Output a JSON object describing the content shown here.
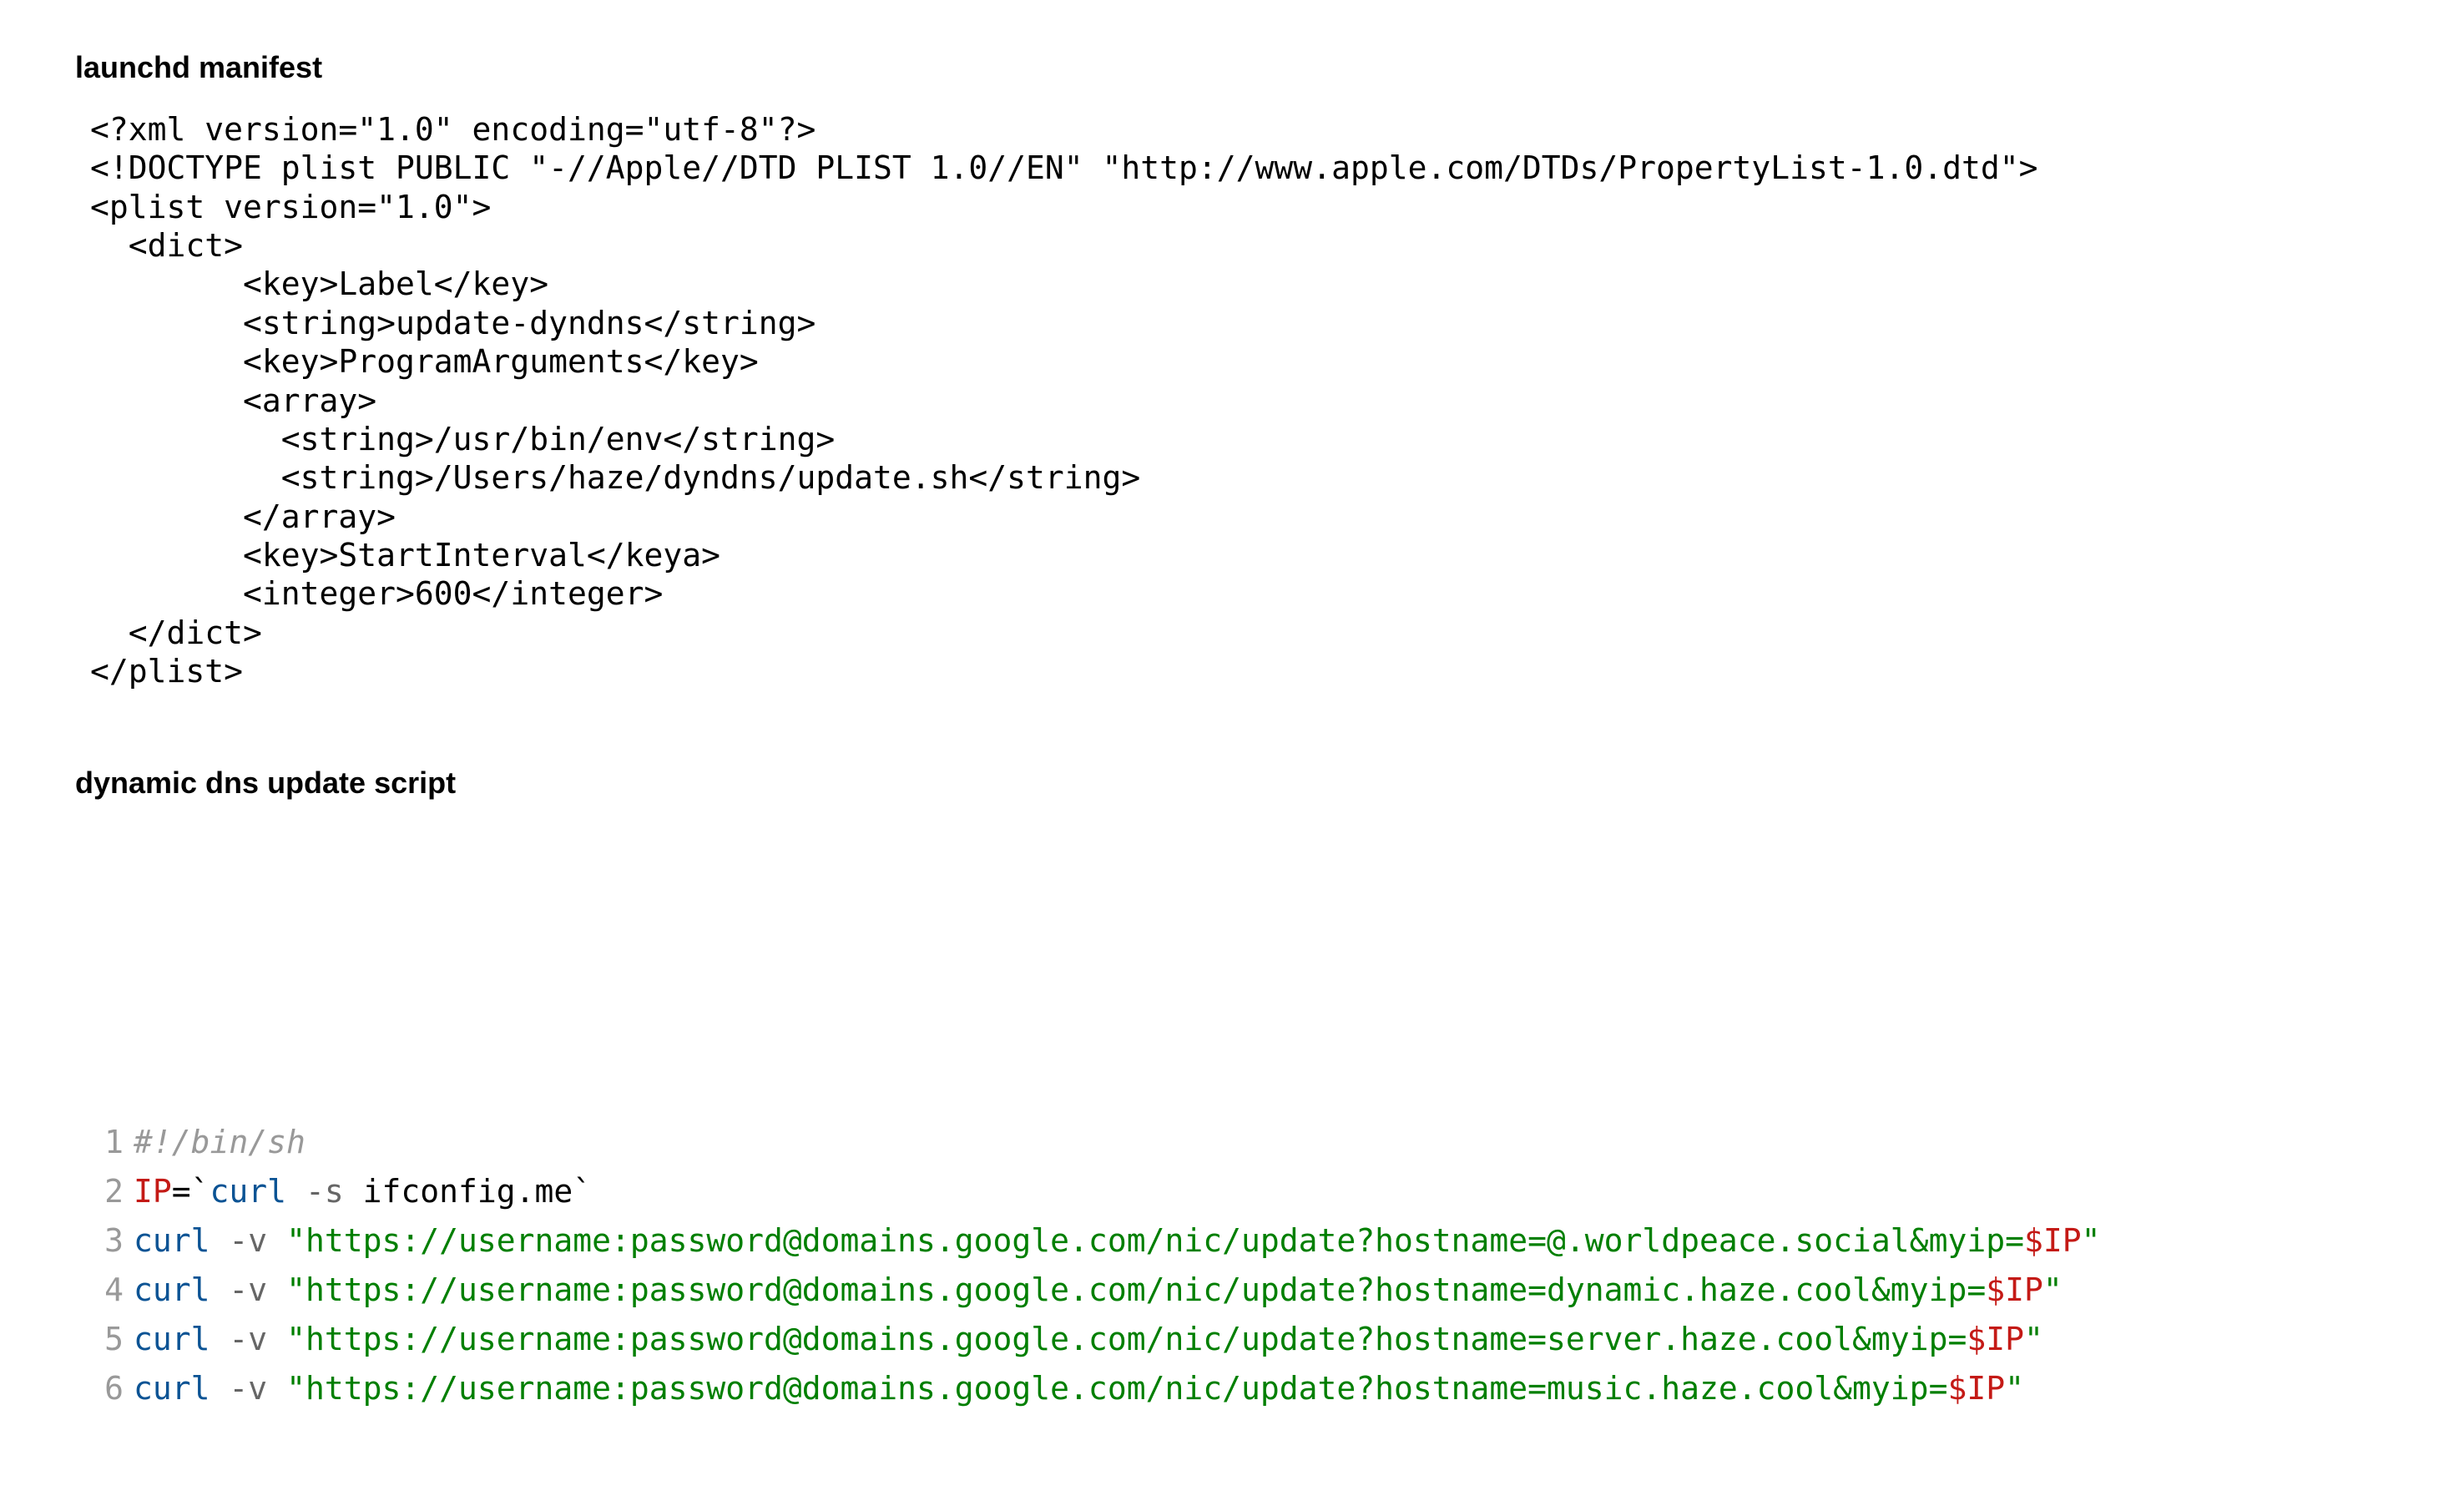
{
  "section1": {
    "heading": "launchd manifest",
    "code": "<?xml version=\"1.0\" encoding=\"utf-8\"?>\n<!DOCTYPE plist PUBLIC \"-//Apple//DTD PLIST 1.0//EN\" \"http://www.apple.com/DTDs/PropertyList-1.0.dtd\">\n<plist version=\"1.0\">\n  <dict>\n        <key>Label</key>\n        <string>update-dyndns</string>\n        <key>ProgramArguments</key>\n        <array>\n          <string>/usr/bin/env</string>\n          <string>/Users/haze/dyndns/update.sh</string>\n        </array>\n        <key>StartInterval</keya>\n        <integer>600</integer>\n  </dict>\n</plist>"
  },
  "section2": {
    "heading": "dynamic dns update script",
    "lines": [
      {
        "num": "1",
        "tokens": [
          {
            "t": "#!/bin/sh",
            "c": "shebang"
          }
        ]
      },
      {
        "num": "2",
        "tokens": [
          {
            "t": "IP",
            "c": "var"
          },
          {
            "t": "=",
            "c": "plain"
          },
          {
            "t": "`",
            "c": "plain"
          },
          {
            "t": "curl",
            "c": "cmd"
          },
          {
            "t": " ",
            "c": "plain"
          },
          {
            "t": "-s",
            "c": "flag"
          },
          {
            "t": " ifconfig.me",
            "c": "plain"
          },
          {
            "t": "`",
            "c": "plain"
          }
        ]
      },
      {
        "num": "3",
        "tokens": [
          {
            "t": "curl",
            "c": "cmd"
          },
          {
            "t": " ",
            "c": "plain"
          },
          {
            "t": "-v",
            "c": "flag"
          },
          {
            "t": " ",
            "c": "plain"
          },
          {
            "t": "\"https://username:password@domains.google.com/nic/update?hostname=@.worldpeace.social&myip=",
            "c": "str"
          },
          {
            "t": "$IP",
            "c": "interp"
          },
          {
            "t": "\"",
            "c": "str"
          }
        ]
      },
      {
        "num": "4",
        "tokens": [
          {
            "t": "curl",
            "c": "cmd"
          },
          {
            "t": " ",
            "c": "plain"
          },
          {
            "t": "-v",
            "c": "flag"
          },
          {
            "t": " ",
            "c": "plain"
          },
          {
            "t": "\"https://username:password@domains.google.com/nic/update?hostname=dynamic.haze.cool&myip=",
            "c": "str"
          },
          {
            "t": "$IP",
            "c": "interp"
          },
          {
            "t": "\"",
            "c": "str"
          }
        ]
      },
      {
        "num": "5",
        "tokens": [
          {
            "t": "curl",
            "c": "cmd"
          },
          {
            "t": " ",
            "c": "plain"
          },
          {
            "t": "-v",
            "c": "flag"
          },
          {
            "t": " ",
            "c": "plain"
          },
          {
            "t": "\"https://username:password@domains.google.com/nic/update?hostname=server.haze.cool&myip=",
            "c": "str"
          },
          {
            "t": "$IP",
            "c": "interp"
          },
          {
            "t": "\"",
            "c": "str"
          }
        ]
      },
      {
        "num": "6",
        "tokens": [
          {
            "t": "curl",
            "c": "cmd"
          },
          {
            "t": " ",
            "c": "plain"
          },
          {
            "t": "-v",
            "c": "flag"
          },
          {
            "t": " ",
            "c": "plain"
          },
          {
            "t": "\"https://username:password@domains.google.com/nic/update?hostname=music.haze.cool&myip=",
            "c": "str"
          },
          {
            "t": "$IP",
            "c": "interp"
          },
          {
            "t": "\"",
            "c": "str"
          }
        ]
      }
    ]
  }
}
